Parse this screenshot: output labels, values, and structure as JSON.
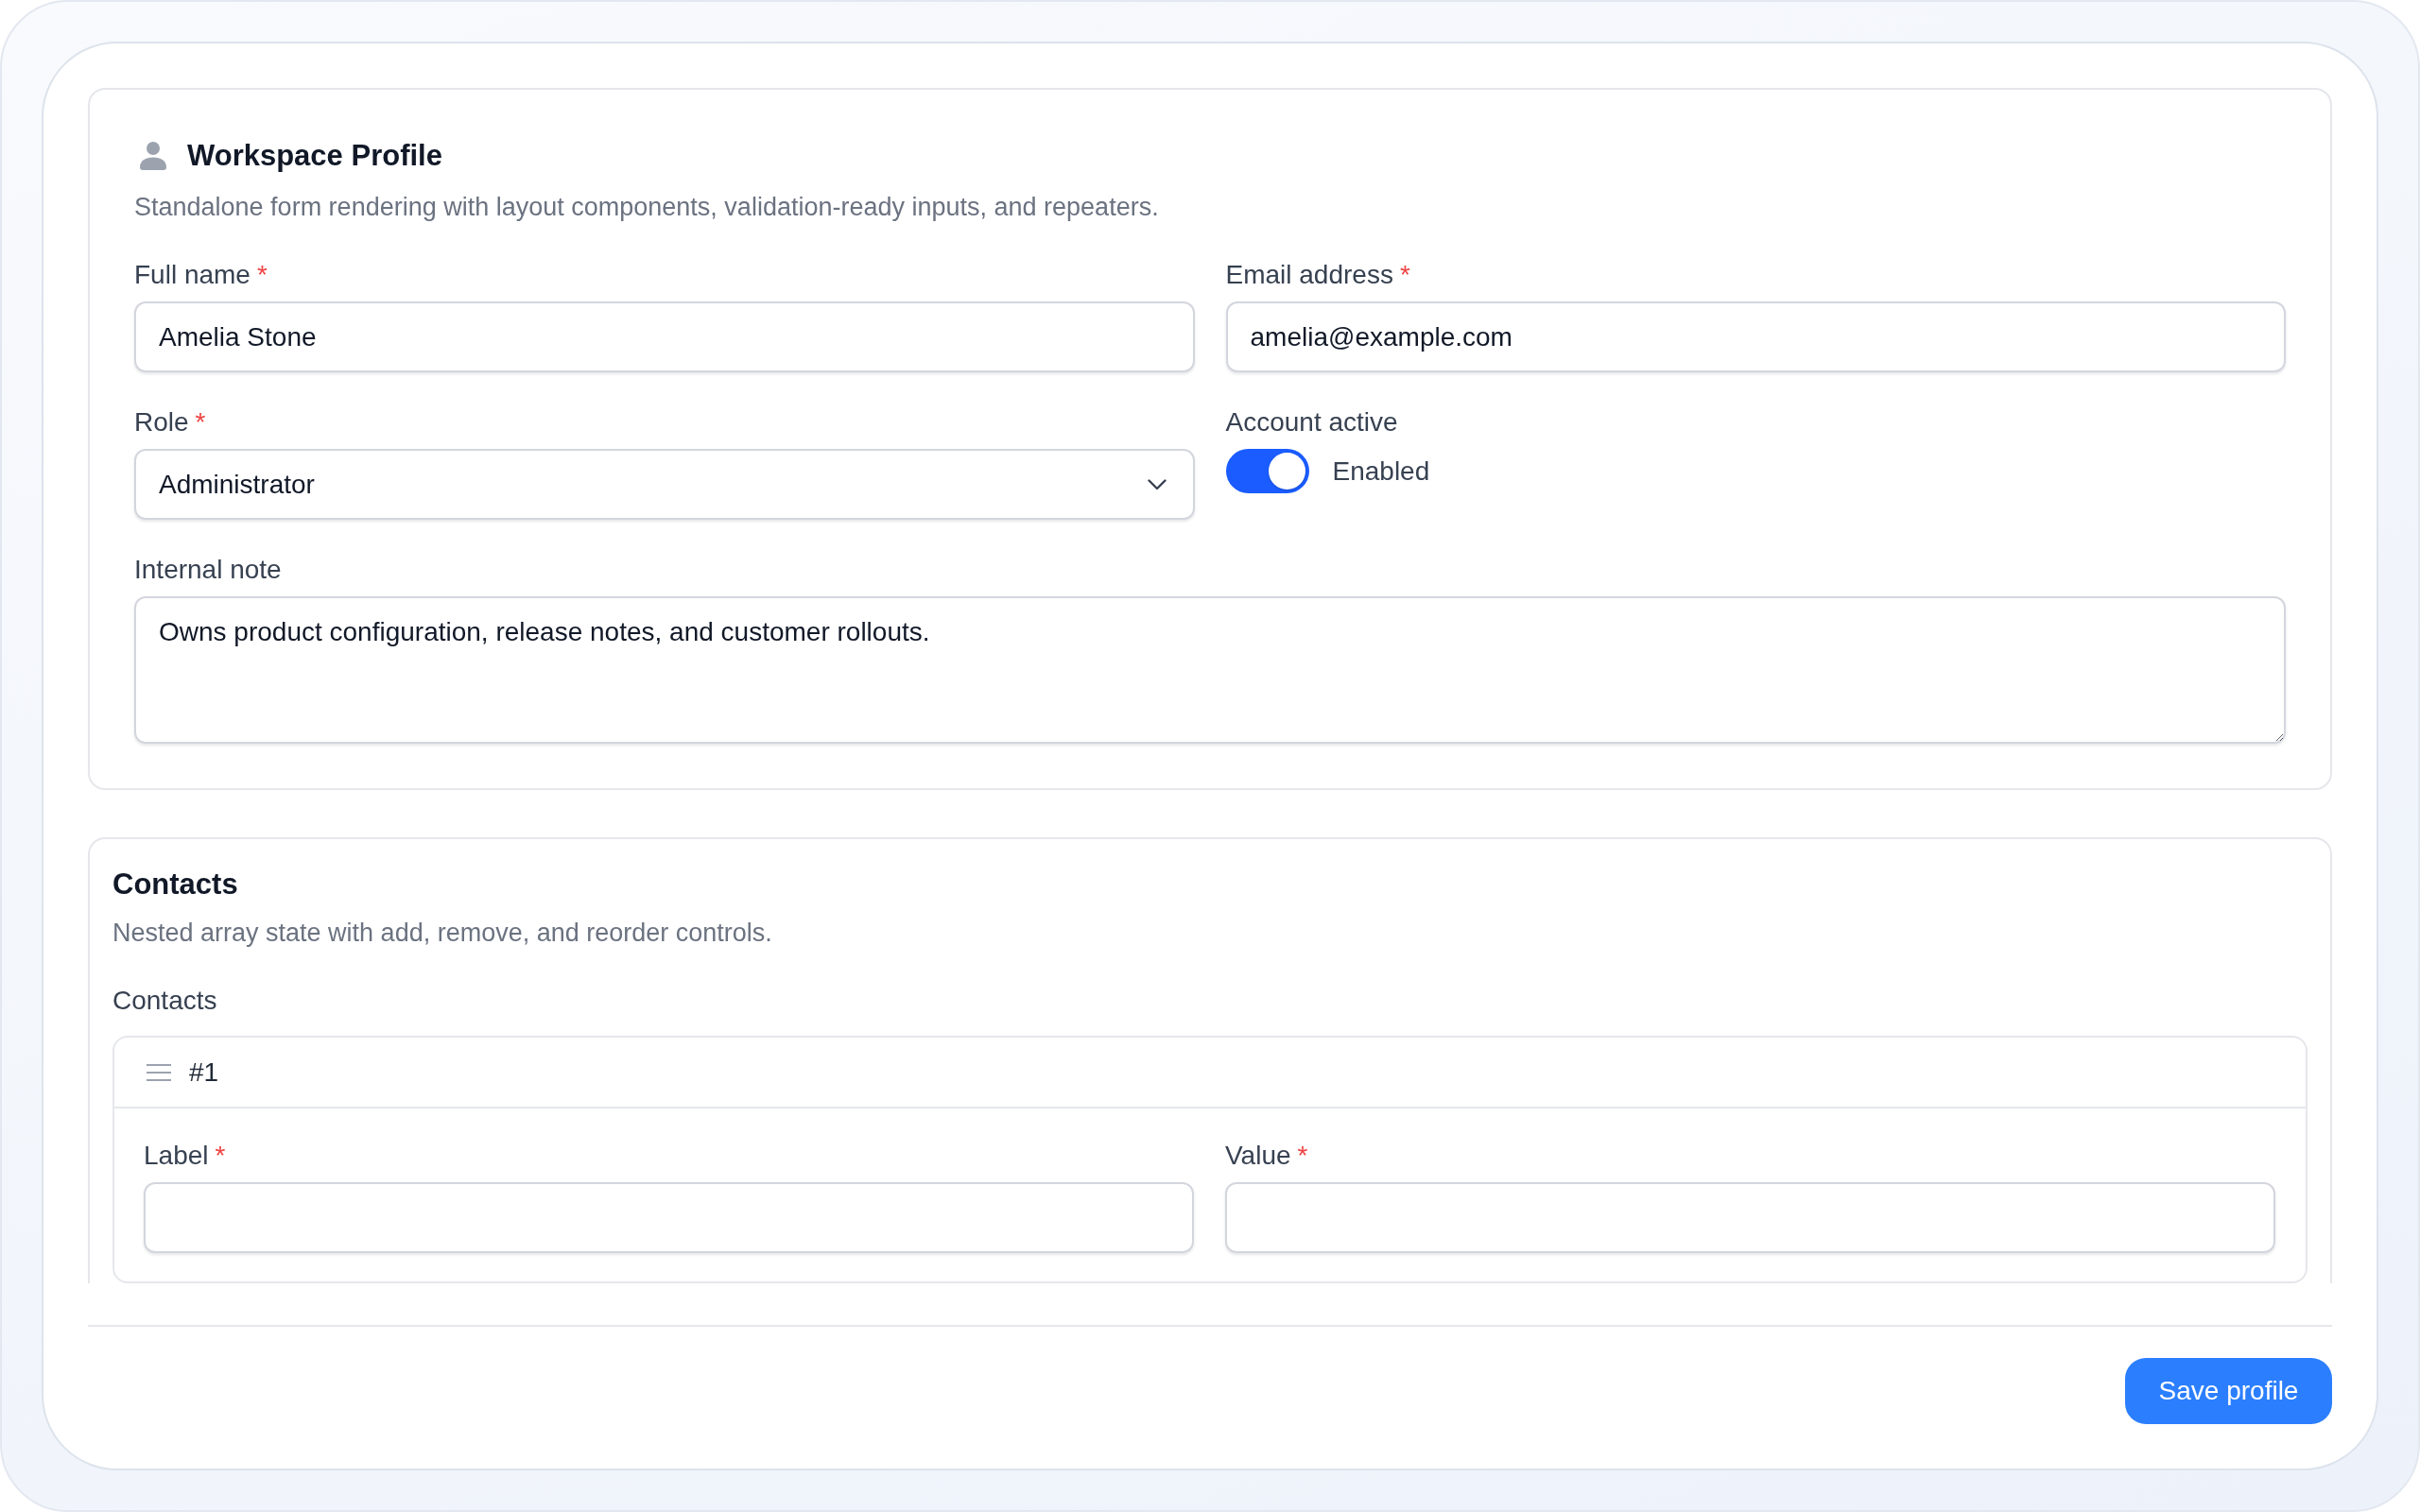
{
  "sections": [
    {
      "kind": "form",
      "title": "Workspace Profile",
      "description": "Standalone form rendering with layout components, validation-ready inputs, and repeaters.",
      "fields": [
        {
          "kind": "text",
          "label": "Full name",
          "required_mark": "*",
          "value": "Amelia Stone"
        },
        {
          "kind": "text",
          "label": "Email address",
          "required_mark": "*",
          "value": "amelia@example.com"
        },
        {
          "kind": "select",
          "label": "Role",
          "required_mark": "*",
          "value": "Administrator"
        },
        {
          "kind": "toggle",
          "label": "Account active",
          "on": true,
          "caption": "Enabled"
        },
        {
          "kind": "textarea",
          "label": "Internal note",
          "value": "Owns product configuration, release notes, and customer rollouts."
        }
      ]
    },
    {
      "kind": "repeater",
      "title": "Contacts",
      "description": "Nested array state with add, remove, and reorder controls.",
      "repeater": {
        "label": "Contacts",
        "items": [
          {
            "index_label": "#1",
            "fields": [
              {
                "kind": "text",
                "label": "Label",
                "required_mark": "*"
              },
              {
                "kind": "text",
                "label": "Value",
                "required_mark": "*"
              }
            ]
          }
        ]
      }
    }
  ],
  "footer": {
    "save_button": "Save profile"
  }
}
